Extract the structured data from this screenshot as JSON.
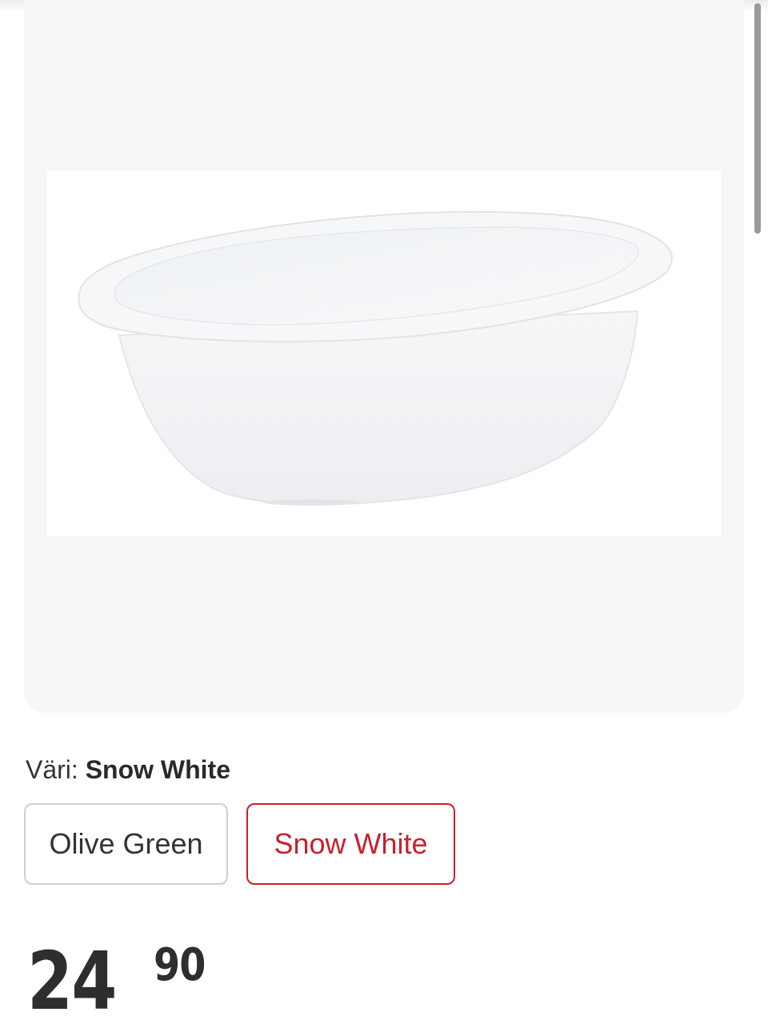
{
  "product": {
    "image_alt": "White oval baby bath tub"
  },
  "color_selector": {
    "label": "Väri:",
    "selected": "Snow White",
    "options": [
      {
        "label": "Olive Green",
        "selected": false
      },
      {
        "label": "Snow White",
        "selected": true
      }
    ],
    "selected_color": "#c9202c"
  },
  "price": {
    "main": "24",
    "cents": "90"
  }
}
